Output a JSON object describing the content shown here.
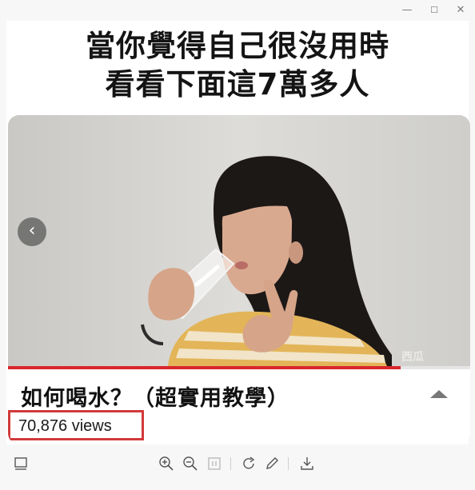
{
  "window": {
    "minimize_glyph": "—",
    "maximize_glyph": "☐",
    "close_glyph": "✕"
  },
  "meme": {
    "caption_line1": "當你覺得自己很沒用時",
    "caption_line2": "看看下面這7萬多人"
  },
  "video": {
    "title": "如何喝水？（超實用教學）",
    "views": "70,876  views",
    "watermark": "西瓜",
    "progress": 0.85,
    "prev_glyph": "‹"
  },
  "toolbar": {
    "icons": [
      "sidebar-icon",
      "zoom-in-icon",
      "zoom-out-icon",
      "fit-page-icon",
      "rotate-icon",
      "edit-icon",
      "download-icon"
    ]
  },
  "colors": {
    "highlight": "#d23a3a",
    "progress": "#d8262d"
  }
}
